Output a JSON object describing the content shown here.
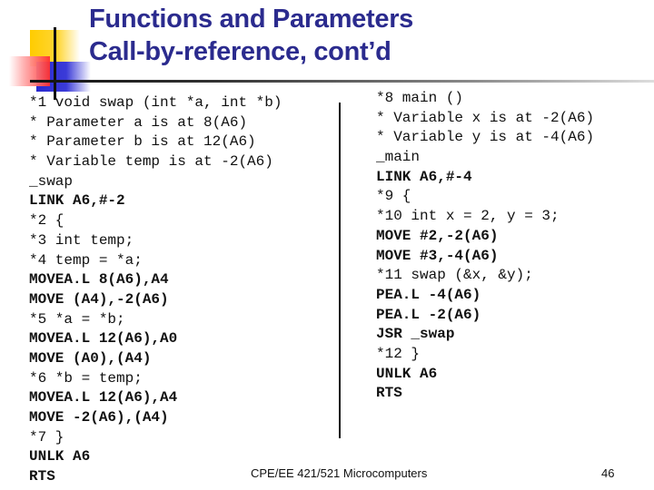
{
  "slide": {
    "title_line1": "Functions and Parameters",
    "title_line2": "Call-by-reference, cont’d",
    "footer": "CPE/EE 421/521 Microcomputers",
    "page_number": "46",
    "title_color": "#2b2b8e"
  },
  "left_code": [
    {
      "text": "*1 void swap (int *a, int *b)",
      "style": "comment"
    },
    {
      "text": "* Parameter a is at 8(A6)",
      "style": "comment"
    },
    {
      "text": "* Parameter b is at 12(A6)",
      "style": "comment"
    },
    {
      "text": "* Variable temp is at -2(A6)",
      "style": "comment"
    },
    {
      "text": "_swap",
      "style": "comment"
    },
    {
      "text": "LINK A6,#-2",
      "style": "instr"
    },
    {
      "text": "*2 {",
      "style": "comment"
    },
    {
      "text": "*3 int temp;",
      "style": "comment"
    },
    {
      "text": "*4 temp = *a;",
      "style": "comment"
    },
    {
      "text": "MOVEA.L 8(A6),A4",
      "style": "instr"
    },
    {
      "text": "MOVE (A4),-2(A6)",
      "style": "instr"
    },
    {
      "text": "*5 *a = *b;",
      "style": "comment"
    },
    {
      "text": "MOVEA.L 12(A6),A0",
      "style": "instr"
    },
    {
      "text": "MOVE (A0),(A4)",
      "style": "instr"
    },
    {
      "text": "*6 *b = temp;",
      "style": "comment"
    },
    {
      "text": "MOVEA.L 12(A6),A4",
      "style": "instr"
    },
    {
      "text": "MOVE -2(A6),(A4)",
      "style": "instr"
    },
    {
      "text": "*7 }",
      "style": "comment"
    },
    {
      "text": "UNLK A6",
      "style": "instr"
    },
    {
      "text": "RTS",
      "style": "instr"
    }
  ],
  "right_code": [
    {
      "text": "*8 main ()",
      "style": "comment"
    },
    {
      "text": "* Variable x is at -2(A6)",
      "style": "comment"
    },
    {
      "text": "* Variable y is at -4(A6)",
      "style": "comment"
    },
    {
      "text": "_main",
      "style": "comment"
    },
    {
      "text": "LINK A6,#-4",
      "style": "instr"
    },
    {
      "text": "*9 {",
      "style": "comment"
    },
    {
      "text": "*10 int x = 2, y = 3;",
      "style": "comment"
    },
    {
      "text": "MOVE #2,-2(A6)",
      "style": "instr"
    },
    {
      "text": "MOVE #3,-4(A6)",
      "style": "instr"
    },
    {
      "text": "*11 swap (&x, &y);",
      "style": "comment"
    },
    {
      "text": "PEA.L -4(A6)",
      "style": "instr"
    },
    {
      "text": "PEA.L -2(A6)",
      "style": "instr"
    },
    {
      "text": "JSR _swap",
      "style": "instr"
    },
    {
      "text": "*12 }",
      "style": "comment"
    },
    {
      "text": "UNLK A6",
      "style": "instr"
    },
    {
      "text": "RTS",
      "style": "instr"
    }
  ]
}
